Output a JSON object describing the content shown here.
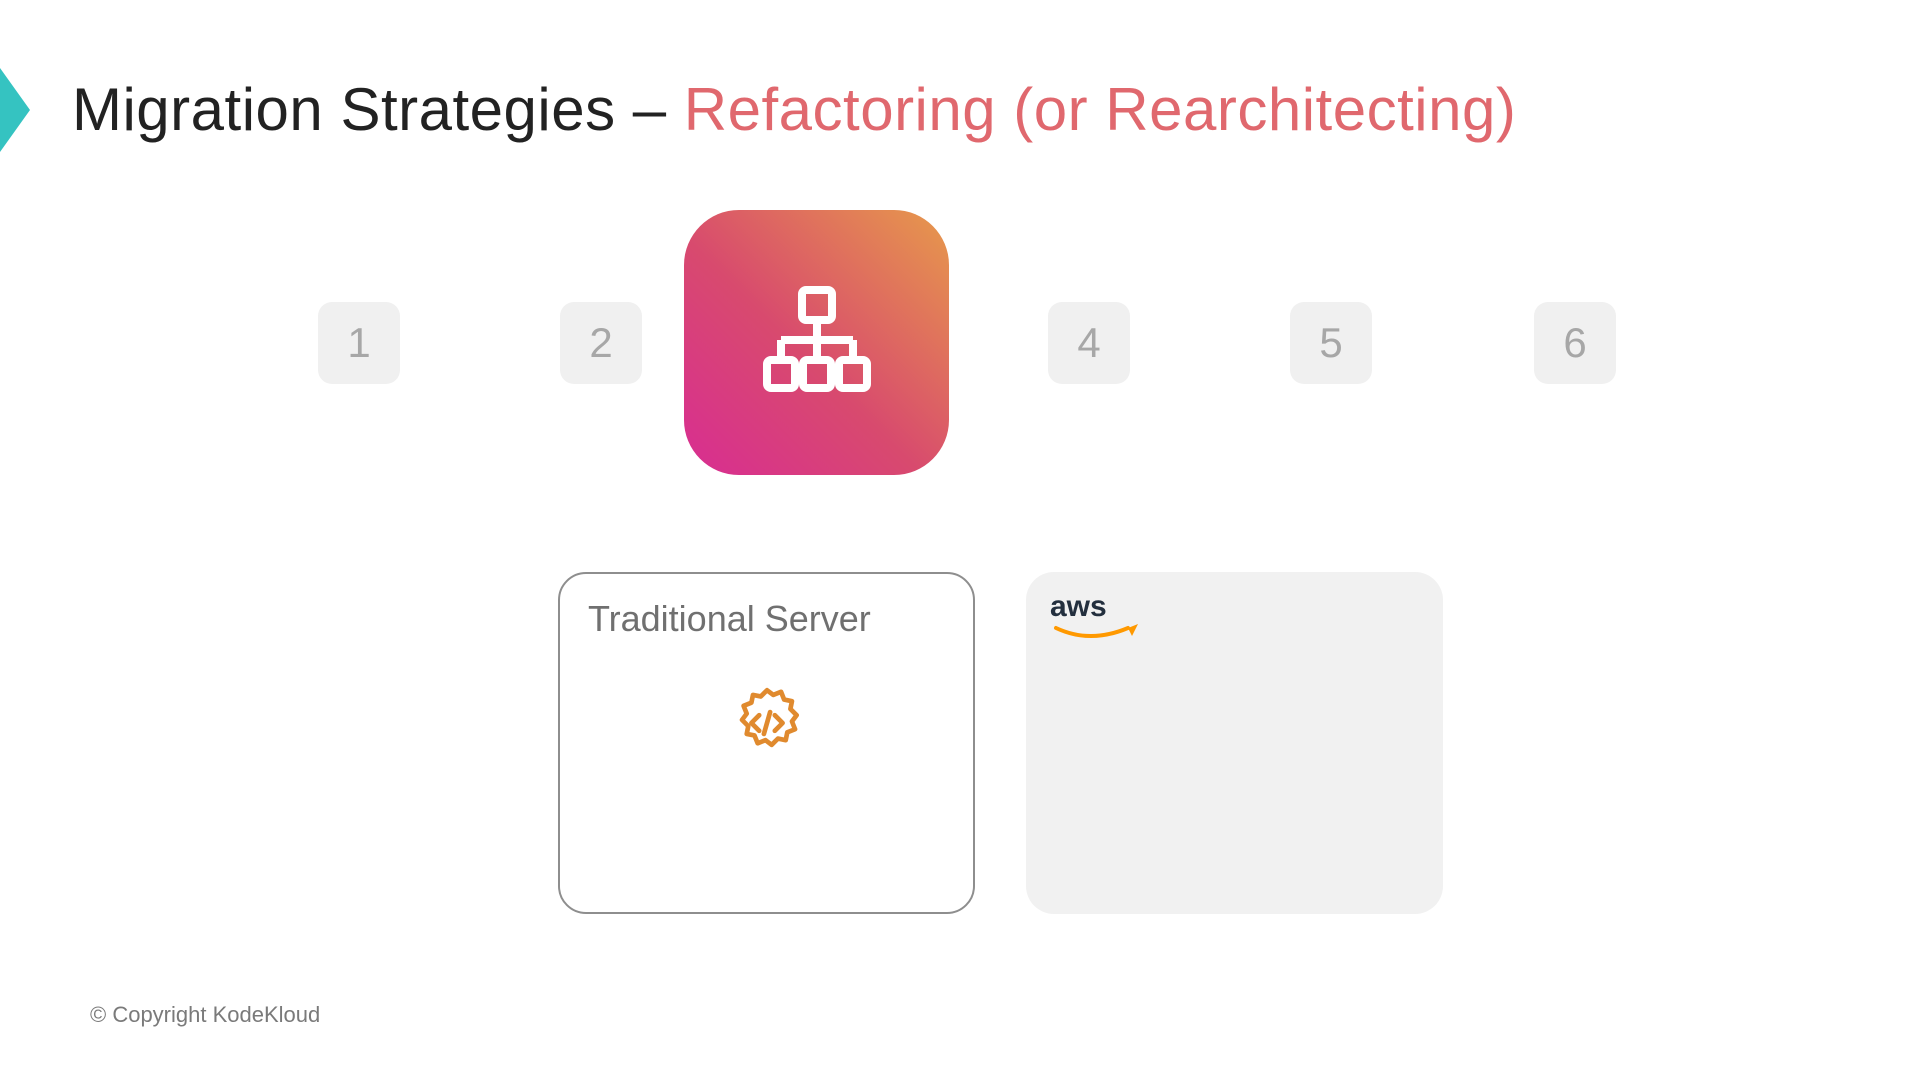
{
  "title": {
    "main": "Migration Strategies – ",
    "highlight": "Refactoring (or Rearchitecting)"
  },
  "steps": {
    "s1": "1",
    "s2": "2",
    "s4": "4",
    "s5": "5",
    "s6": "6",
    "active_icon": "hierarchy-icon"
  },
  "panels": {
    "left": {
      "title": "Traditional Server",
      "icon": "code-gear-icon"
    },
    "right": {
      "logo": "aws-logo"
    }
  },
  "footer": {
    "copyright": "© Copyright KodeKloud"
  },
  "colors": {
    "highlight": "#e0686e",
    "step_bg": "#f0f0f0",
    "step_fg": "#a7a7a7",
    "gradient_a": "#d82d92",
    "gradient_b": "#e79a4b",
    "panel_border": "#8e8e8e",
    "panel_muted_bg": "#f1f1f1",
    "gear_orange": "#e08a2e",
    "aws_text": "#232f3e",
    "aws_smile": "#ff9900"
  }
}
